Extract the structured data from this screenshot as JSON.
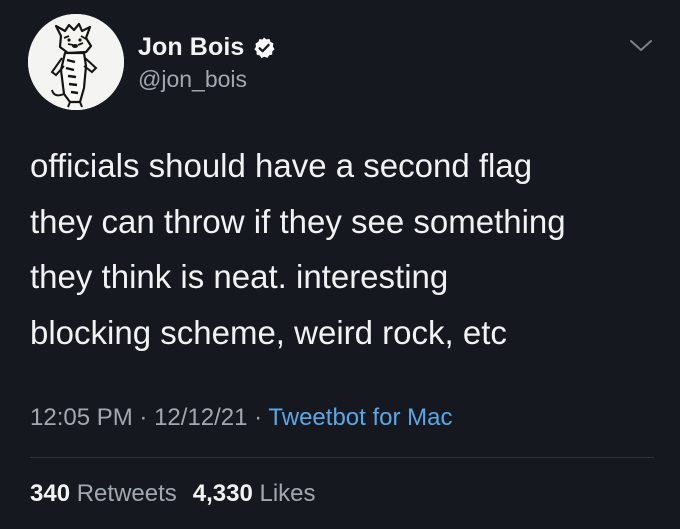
{
  "tweet": {
    "author": {
      "display_name": "Jon Bois",
      "handle": "@jon_bois",
      "verified_icon": "verified-badge-icon",
      "avatar_icon": "cartoon-tiger-avatar"
    },
    "menu_icon": "chevron-down-icon",
    "text_lines": [
      "officials should have a second flag",
      "they can throw if they see something",
      "they think is neat. interesting",
      "blocking scheme, weird rock, etc"
    ],
    "time": "12:05 PM",
    "date": "12/12/21",
    "separator": "·",
    "client": "Tweetbot for Mac",
    "stats": {
      "retweets_count": "340",
      "retweets_label": "Retweets",
      "likes_count": "4,330",
      "likes_label": "Likes"
    }
  },
  "colors": {
    "background": "#15181e",
    "text": "#f1f2f4",
    "muted": "#a2a8b0",
    "link": "#5aa7e8"
  }
}
